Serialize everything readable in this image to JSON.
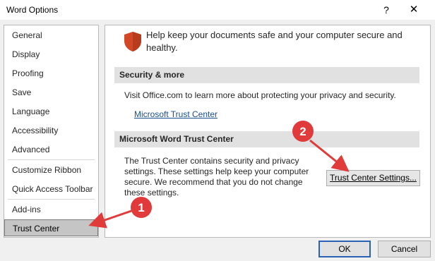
{
  "window": {
    "title": "Word Options",
    "help_glyph": "?",
    "close_glyph": "✕"
  },
  "sidebar": {
    "items": [
      {
        "label": "General"
      },
      {
        "label": "Display"
      },
      {
        "label": "Proofing"
      },
      {
        "label": "Save"
      },
      {
        "label": "Language"
      },
      {
        "label": "Accessibility"
      },
      {
        "label": "Advanced"
      },
      {
        "label": "Customize Ribbon"
      },
      {
        "label": "Quick Access Toolbar"
      },
      {
        "label": "Add-ins"
      },
      {
        "label": "Trust Center",
        "selected": true
      }
    ]
  },
  "main": {
    "header_line1": "Help keep your documents safe and your computer secure and",
    "header_line2": "healthy.",
    "security_section": {
      "heading": "Security & more",
      "text": "Visit Office.com to learn more about protecting your privacy and security.",
      "link": "Microsoft Trust Center"
    },
    "trust_center_section": {
      "heading": "Microsoft Word Trust Center",
      "line1": "The Trust Center contains security and privacy",
      "line2": "settings. These settings help keep your computer",
      "line3": "secure. We recommend that you do not change",
      "line4": "these settings.",
      "button_label": "Trust Center Settings..."
    }
  },
  "footer": {
    "ok_label": "OK",
    "cancel_label": "Cancel"
  },
  "annotations": {
    "badge1": "1",
    "badge2": "2"
  },
  "colors": {
    "annotation_red": "#e03a3a",
    "shield_orange": "#d24726",
    "selected_bg": "#c5c5c5",
    "link_blue": "#1a4e8e"
  }
}
